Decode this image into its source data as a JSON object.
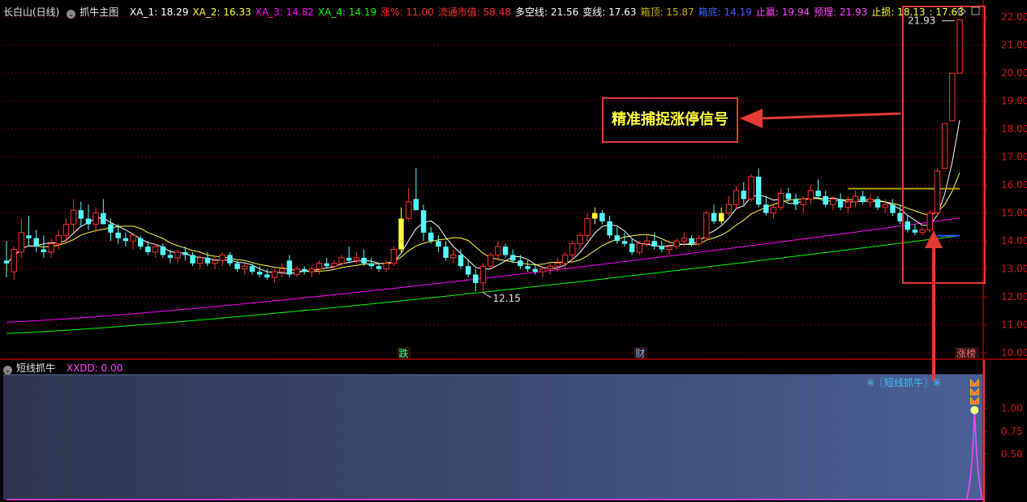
{
  "main_legend": {
    "stock_name": "长白山(日线)",
    "formula_name": "抓牛主图",
    "items": [
      {
        "label": "XA_1: 18.29",
        "color": "#ffffff"
      },
      {
        "label": "XA_2: 16.33",
        "color": "#ffff3c"
      },
      {
        "label": "XA_3: 14.82",
        "color": "#ff00ff"
      },
      {
        "label": "XA_4: 14.19",
        "color": "#00ff00"
      },
      {
        "label": "涨%: 11.00",
        "color": "#ff3030"
      },
      {
        "label": "流通市值: 58.48",
        "color": "#ff3030"
      },
      {
        "label": "多空线: 21.56",
        "color": "#ffffff"
      },
      {
        "label": "变线: 17.63",
        "color": "#ffffff"
      },
      {
        "label": "箱顶: 15.87",
        "color": "#c8b400"
      },
      {
        "label": "箱底: 14.19",
        "color": "#4060ff"
      },
      {
        "label": "止赢: 19.94",
        "color": "#ff44ff"
      },
      {
        "label": "预理: 21.93",
        "color": "#ff44ff"
      },
      {
        "label": "止损: 18.13",
        "color": "#ffff3c"
      },
      {
        "label": ": 17.63",
        "color": "#ffff3c"
      }
    ]
  },
  "sub_legend": {
    "formula_name": "短线抓牛",
    "items": [
      {
        "label": "XXDD: 0.00",
        "color": "#ff44ff"
      }
    ]
  },
  "annotations": {
    "callout_text": "精准捕捉涨停信号",
    "high_marker": "21.93",
    "low_marker": "12.15",
    "event_1": "跌",
    "event_2": "财",
    "event_3": "涨榜",
    "signal_text": "※〖短线抓牛〗※"
  },
  "colors": {
    "up": "#ff3030",
    "down_fill": "#54ffff",
    "grid": "#7a0000",
    "axis": "#b00000",
    "callout_border": "#e53935",
    "callout_text": "#ffff3c"
  },
  "chart_data": [
    {
      "type": "candlestick",
      "title": "长白山(日线)",
      "y_ticks": [
        "22.00",
        "21.00",
        "20.00",
        "19.00",
        "18.00",
        "17.00",
        "16.00",
        "15.00",
        "14.00",
        "13.00",
        "12.00",
        "11.00",
        "10.00"
      ],
      "ylim": [
        9.8,
        22.5
      ],
      "grid": true,
      "candles": [
        [
          13.3,
          14.0,
          12.7,
          13.2
        ],
        [
          12.9,
          13.8,
          12.6,
          13.7
        ],
        [
          13.6,
          14.8,
          13.4,
          14.3
        ],
        [
          14.2,
          14.9,
          13.8,
          14.1
        ],
        [
          14.1,
          14.4,
          13.6,
          13.8
        ],
        [
          13.7,
          14.2,
          13.4,
          13.6
        ],
        [
          13.6,
          14.1,
          13.4,
          13.9
        ],
        [
          13.9,
          14.4,
          13.7,
          14.2
        ],
        [
          14.2,
          14.8,
          13.9,
          14.6
        ],
        [
          14.6,
          15.5,
          14.3,
          15.1
        ],
        [
          15.1,
          15.4,
          14.5,
          14.8
        ],
        [
          14.8,
          15.3,
          14.4,
          14.6
        ],
        [
          14.6,
          15.2,
          14.3,
          15.0
        ],
        [
          15.0,
          15.5,
          14.6,
          14.6
        ],
        [
          14.6,
          14.8,
          14.0,
          14.3
        ],
        [
          14.3,
          14.6,
          13.9,
          14.1
        ],
        [
          14.1,
          14.3,
          13.8,
          14.0
        ],
        [
          14.0,
          14.3,
          13.7,
          14.2
        ],
        [
          14.1,
          14.2,
          13.7,
          13.8
        ],
        [
          13.8,
          14.0,
          13.5,
          13.6
        ],
        [
          13.6,
          13.9,
          13.4,
          13.8
        ],
        [
          13.8,
          13.9,
          13.4,
          13.5
        ],
        [
          13.5,
          13.7,
          13.2,
          13.4
        ],
        [
          13.4,
          13.7,
          13.2,
          13.6
        ],
        [
          13.6,
          13.8,
          13.3,
          13.5
        ],
        [
          13.5,
          13.6,
          13.1,
          13.2
        ],
        [
          13.2,
          13.5,
          13.0,
          13.4
        ],
        [
          13.4,
          13.6,
          13.1,
          13.2
        ],
        [
          13.2,
          13.5,
          13.0,
          13.3
        ],
        [
          13.3,
          13.6,
          13.1,
          13.5
        ],
        [
          13.5,
          13.6,
          13.1,
          13.2
        ],
        [
          13.2,
          13.3,
          12.9,
          13.0
        ],
        [
          13.0,
          13.2,
          12.8,
          13.1
        ],
        [
          13.1,
          13.2,
          12.8,
          12.9
        ],
        [
          12.9,
          13.1,
          12.7,
          12.8
        ],
        [
          12.8,
          13.0,
          12.6,
          12.7
        ],
        [
          12.7,
          13.0,
          12.5,
          12.9
        ],
        [
          12.9,
          13.2,
          12.7,
          13.0
        ],
        [
          13.3,
          13.5,
          12.7,
          12.8
        ],
        [
          12.8,
          13.1,
          12.7,
          13.0
        ],
        [
          13.0,
          13.1,
          12.8,
          12.9
        ],
        [
          12.9,
          13.1,
          12.7,
          13.0
        ],
        [
          13.0,
          13.3,
          12.8,
          13.2
        ],
        [
          13.2,
          13.4,
          13.0,
          13.1
        ],
        [
          13.1,
          13.3,
          13.0,
          13.2
        ],
        [
          13.2,
          13.5,
          13.1,
          13.4
        ],
        [
          13.4,
          13.8,
          13.2,
          13.3
        ],
        [
          13.3,
          13.6,
          13.2,
          13.4
        ],
        [
          13.4,
          13.7,
          13.1,
          13.2
        ],
        [
          13.2,
          13.4,
          13.0,
          13.1
        ],
        [
          13.1,
          13.2,
          12.9,
          13.0
        ],
        [
          13.0,
          13.3,
          12.9,
          13.2
        ],
        [
          13.2,
          13.8,
          13.1,
          13.7
        ],
        [
          13.7,
          15.2,
          13.6,
          14.8
        ],
        [
          14.8,
          15.9,
          14.7,
          15.4
        ],
        [
          15.5,
          16.6,
          15.2,
          15.1
        ],
        [
          15.1,
          15.3,
          14.0,
          14.3
        ],
        [
          14.3,
          14.5,
          13.9,
          14.0
        ],
        [
          14.0,
          14.2,
          13.6,
          13.8
        ],
        [
          13.8,
          14.0,
          13.3,
          13.4
        ],
        [
          13.4,
          13.7,
          13.2,
          13.5
        ],
        [
          13.5,
          13.7,
          13.0,
          13.1
        ],
        [
          13.1,
          13.3,
          12.7,
          12.8
        ],
        [
          12.8,
          13.0,
          12.2,
          12.5
        ],
        [
          12.5,
          13.2,
          12.15,
          13.1
        ],
        [
          13.1,
          13.6,
          13.0,
          13.5
        ],
        [
          13.5,
          14.0,
          13.3,
          13.8
        ],
        [
          13.8,
          13.9,
          13.4,
          13.5
        ],
        [
          13.5,
          13.7,
          13.2,
          13.3
        ],
        [
          13.3,
          13.5,
          13.0,
          13.1
        ],
        [
          13.1,
          13.3,
          12.9,
          13.0
        ],
        [
          13.0,
          13.2,
          12.8,
          12.9
        ],
        [
          12.9,
          13.1,
          12.7,
          13.0
        ],
        [
          13.0,
          13.2,
          12.8,
          13.1
        ],
        [
          13.1,
          13.4,
          12.9,
          13.2
        ],
        [
          13.2,
          13.6,
          13.0,
          13.5
        ],
        [
          13.5,
          14.0,
          13.3,
          13.9
        ],
        [
          13.9,
          14.3,
          13.7,
          14.2
        ],
        [
          14.2,
          15.0,
          14.0,
          14.8
        ],
        [
          14.8,
          15.2,
          14.6,
          15.0
        ],
        [
          15.0,
          15.1,
          14.6,
          14.7
        ],
        [
          14.7,
          14.9,
          14.1,
          14.2
        ],
        [
          14.2,
          14.5,
          13.9,
          14.0
        ],
        [
          14.0,
          14.3,
          13.8,
          13.9
        ],
        [
          13.9,
          14.1,
          13.5,
          13.6
        ],
        [
          13.6,
          14.0,
          13.5,
          13.9
        ],
        [
          13.9,
          14.2,
          13.8,
          14.0
        ],
        [
          14.0,
          14.3,
          13.7,
          13.8
        ],
        [
          13.8,
          14.0,
          13.6,
          13.7
        ],
        [
          13.7,
          13.9,
          13.5,
          13.8
        ],
        [
          13.8,
          14.1,
          13.7,
          14.0
        ],
        [
          14.0,
          14.3,
          13.8,
          14.1
        ],
        [
          14.1,
          14.2,
          13.8,
          13.9
        ],
        [
          13.9,
          14.2,
          13.8,
          14.1
        ],
        [
          14.1,
          15.1,
          14.0,
          15.0
        ],
        [
          15.0,
          15.3,
          14.6,
          14.7
        ],
        [
          14.7,
          15.2,
          14.6,
          15.0
        ],
        [
          15.0,
          15.6,
          14.9,
          15.3
        ],
        [
          15.3,
          16.0,
          15.1,
          15.8
        ],
        [
          15.8,
          16.1,
          15.3,
          15.5
        ],
        [
          15.5,
          16.4,
          15.4,
          16.3
        ],
        [
          16.3,
          16.6,
          15.2,
          15.3
        ],
        [
          15.3,
          15.6,
          14.9,
          15.0
        ],
        [
          15.0,
          15.3,
          14.8,
          15.2
        ],
        [
          15.2,
          15.9,
          15.1,
          15.7
        ],
        [
          15.7,
          15.9,
          15.4,
          15.5
        ],
        [
          15.5,
          15.7,
          15.1,
          15.3
        ],
        [
          15.3,
          15.6,
          15.0,
          15.5
        ],
        [
          15.5,
          16.0,
          15.3,
          15.8
        ],
        [
          15.8,
          16.2,
          15.5,
          15.6
        ],
        [
          15.6,
          15.8,
          15.2,
          15.3
        ],
        [
          15.3,
          15.6,
          15.1,
          15.5
        ],
        [
          15.5,
          15.7,
          15.1,
          15.2
        ],
        [
          15.2,
          15.6,
          15.0,
          15.4
        ],
        [
          15.4,
          15.8,
          15.2,
          15.6
        ],
        [
          15.6,
          15.8,
          15.3,
          15.4
        ],
        [
          15.4,
          15.7,
          15.2,
          15.5
        ],
        [
          15.5,
          15.6,
          15.1,
          15.2
        ],
        [
          15.2,
          15.5,
          15.0,
          15.3
        ],
        [
          15.3,
          15.5,
          14.9,
          15.0
        ],
        [
          15.0,
          15.3,
          14.6,
          14.7
        ],
        [
          14.7,
          14.9,
          14.3,
          14.4
        ],
        [
          14.4,
          14.6,
          14.2,
          14.3
        ],
        [
          14.3,
          14.5,
          14.2,
          14.4
        ],
        [
          14.4,
          15.1,
          14.3,
          15.0
        ],
        [
          15.0,
          16.6,
          14.9,
          16.5
        ],
        [
          16.6,
          18.2,
          16.6,
          18.2
        ],
        [
          18.3,
          20.0,
          18.3,
          20.0
        ],
        [
          20.0,
          21.93,
          20.0,
          21.9
        ]
      ],
      "up_flat_markers_yellow": [
        53,
        79,
        96,
        129,
        130
      ],
      "ma_series": [
        {
          "name": "XA_1",
          "value": 18.29,
          "color": "#ffffff"
        },
        {
          "name": "XA_2",
          "value": 16.33,
          "color": "#ffff3c"
        },
        {
          "name": "XA_3",
          "value": 14.82,
          "color": "#ff00ff"
        },
        {
          "name": "XA_4",
          "value": 14.19,
          "color": "#00ff00"
        }
      ],
      "box_top": 15.87,
      "box_bottom": 14.19
    },
    {
      "type": "line",
      "title": "短线抓牛",
      "series": [
        {
          "name": "XXDD",
          "value": 0.0,
          "color": "#ff44ff"
        }
      ],
      "y_ticks": [
        "1.00",
        "0.75",
        "0.50"
      ],
      "ylim": [
        0,
        1.3
      ],
      "spike": {
        "candle_index": 130,
        "peak": 1.0
      }
    }
  ]
}
